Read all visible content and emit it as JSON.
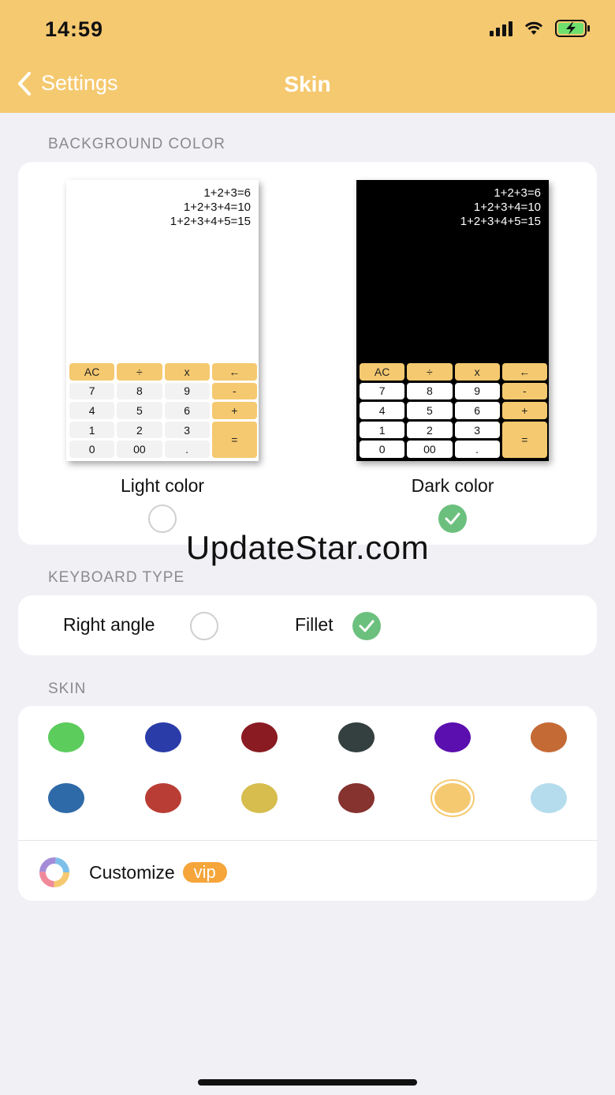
{
  "status": {
    "time": "14:59"
  },
  "nav": {
    "back_label": "Settings",
    "title": "Skin"
  },
  "background": {
    "section_label": "BACKGROUND COLOR",
    "expressions": [
      "1+2+3=6",
      "1+2+3+4=10",
      "1+2+3+4+5=15"
    ],
    "keys": [
      "AC",
      "÷",
      "x",
      "←",
      "7",
      "8",
      "9",
      "-",
      "4",
      "5",
      "6",
      "+",
      "1",
      "2",
      "3",
      "=",
      "0",
      "00",
      "."
    ],
    "options": [
      {
        "label": "Light color",
        "checked": false
      },
      {
        "label": "Dark color",
        "checked": true
      }
    ]
  },
  "watermark": "UpdateStar.com",
  "keyboard": {
    "section_label": "KEYBOARD TYPE",
    "options": [
      {
        "label": "Right angle",
        "checked": false
      },
      {
        "label": "Fillet",
        "checked": true
      }
    ]
  },
  "skin": {
    "section_label": "SKIN",
    "colors": [
      "#5ccc5c",
      "#2a3ca8",
      "#8a1b22",
      "#343f3f",
      "#5a0fae",
      "#c46a35",
      "#2f6aa8",
      "#b93d34",
      "#d6bd4e",
      "#86322e",
      "#f5c970",
      "#b4dcec"
    ],
    "selected_index": 10,
    "customize_label": "Customize",
    "vip_label": "vip"
  }
}
